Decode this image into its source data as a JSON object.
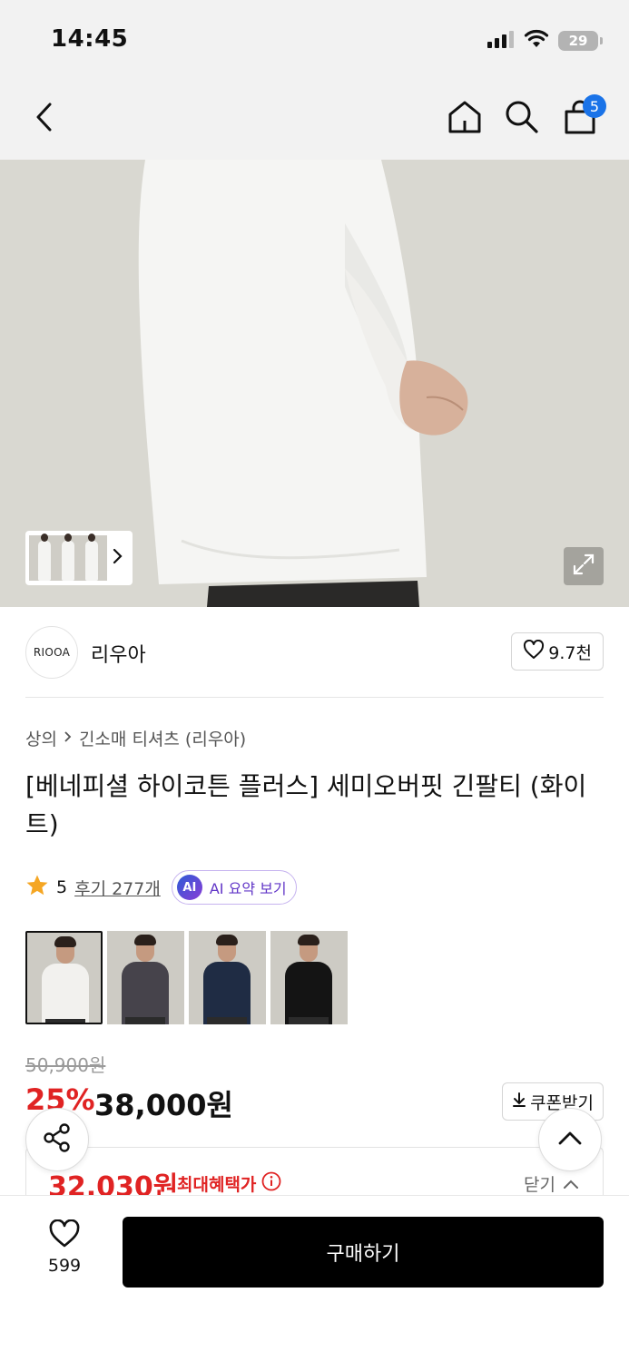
{
  "status_bar": {
    "time": "14:45",
    "battery": "29",
    "icons": [
      "signal-icon",
      "wifi-icon",
      "battery-icon"
    ]
  },
  "nav": {
    "back_icon": "chevron-left-icon",
    "home_icon": "home-icon",
    "search_icon": "search-icon",
    "cart_icon": "shopping-bag-icon",
    "cart_count": "5"
  },
  "brand": {
    "logo_text": "RIOOA",
    "name": "리우아",
    "like_count": "9.7천"
  },
  "breadcrumb": {
    "category": "상의",
    "subcategory": "긴소매 티셔츠 (리우아)"
  },
  "product": {
    "title": "[베네피셜 하이코튼 플러스] 세미오버핏 긴팔티 (화이트)",
    "rating": "5",
    "review_link": "후기 277개",
    "ai_badge": "AI",
    "ai_summary": "AI 요약 보기"
  },
  "swatches": [
    {
      "color_name": "white",
      "shirt_color": "#f2f1ee",
      "selected": true
    },
    {
      "color_name": "charcoal",
      "shirt_color": "#46434b",
      "selected": false
    },
    {
      "color_name": "navy",
      "shirt_color": "#1f2c44",
      "selected": false
    },
    {
      "color_name": "black",
      "shirt_color": "#141414",
      "selected": false
    }
  ],
  "price": {
    "original": "50,900원",
    "discount_rate": "25%",
    "sale": "38,000원",
    "coupon_label": "쿠폰받기",
    "max_benefit_price": "32,030원",
    "max_benefit_label": "최대혜택가",
    "toggle_label": "닫기"
  },
  "bottom": {
    "wish_count": "599",
    "buy_label": "구매하기"
  },
  "colors": {
    "accent_red": "#e02323",
    "badge_blue": "#1a73e8",
    "ai_purple": "#6135c7",
    "buy_button": "#000000"
  }
}
